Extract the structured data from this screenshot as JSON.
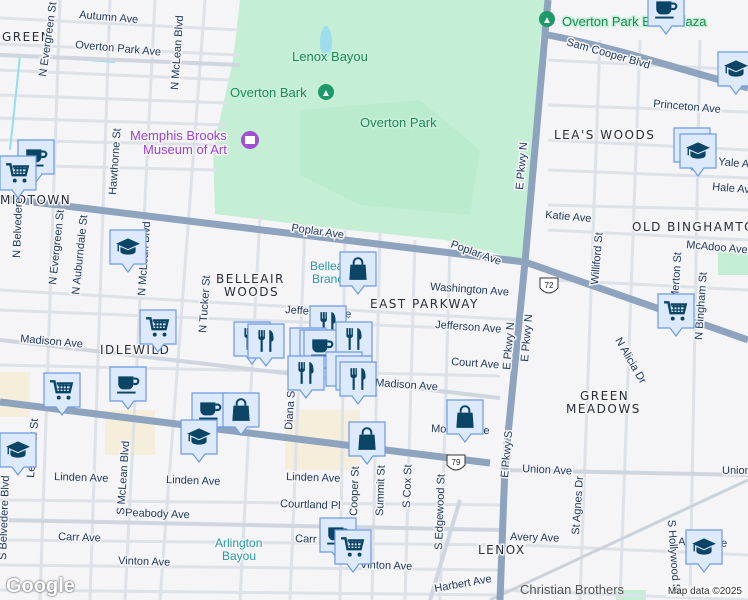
{
  "map": {
    "attribution": "Map data ©2025",
    "logo": "Google",
    "colors": {
      "park": "#c4efd5",
      "road_major": "#8ea3bd",
      "marker_bg": "#dde9fc",
      "marker_border": "#6e9be4",
      "marker_glyph": "#0b4566"
    },
    "neighborhoods": [
      "GREEN",
      "MIDTOWN",
      "BELLEAIR",
      "WOODS",
      "EAST PARKWAY",
      "IDLEWILD",
      "LEA'S WOODS",
      "OLD BINGHAMTON",
      "GREEN",
      "MEADOWS",
      "LENOX"
    ],
    "pois": {
      "lenox_bayou": "Lenox Bayou",
      "overton_bark": "Overton Bark",
      "overton_park": "Overton Park",
      "overton_park_plaza": "Overton Park Bowl Plaza",
      "museum_line1": "Memphis Brooks",
      "museum_line2": "Museum of Art",
      "belleair_line1": "Belleair",
      "belleair_line2": "Branch",
      "arlington_line1": "Arlington",
      "arlington_line2": "Bayou",
      "christian_brothers": "Christian Brothers"
    },
    "streets": [
      "Autumn Ave",
      "Overton Park Ave",
      "N Evergreen St",
      "N McLean Blvd",
      "Hawthorne St",
      "Poplar Ave",
      "Poplar Ave",
      "N Belvedere Blvd",
      "N Evergreen St",
      "N Auburndale St",
      "N McLean Blvd",
      "N Tucker St",
      "Madison Ave",
      "Madison Ave",
      "Jefferson Ave",
      "Jefferson Ave",
      "Washington Ave",
      "Court Ave",
      "Sam Cooper Blvd",
      "Princeton Ave",
      "Yale Ave",
      "Hale Ave",
      "Katie Ave",
      "McAdoo Ave",
      "Williford St",
      "E Pkwy N",
      "E Pkwy N",
      "E Pkwy N",
      "E Pkwy S",
      "Union Ave",
      "Union Ave",
      "Linden Ave",
      "Linden Ave",
      "Linden Ave",
      "Courtland Pl",
      "Peabody Ave",
      "Carr Ave",
      "Carr Ave",
      "Vinton Ave",
      "Vinton Ave",
      "S McLean Blvd",
      "S Belvedere Blvd",
      "Lemaster St",
      "Diana St",
      "Cooper St",
      "Summit St",
      "S Cox St",
      "S Edgewood St",
      "Monroe Ave",
      "Avery Ave",
      "Avery Ave",
      "Harbert Ave",
      "St Agnes Dr",
      "N Alicia Dr",
      "S Hollywood St",
      "N Bingham St",
      "Merton St"
    ],
    "route_shields": [
      "72",
      "79"
    ],
    "marker_kinds": [
      "cafe",
      "school",
      "shopping-bag",
      "grocery",
      "restaurant"
    ]
  }
}
